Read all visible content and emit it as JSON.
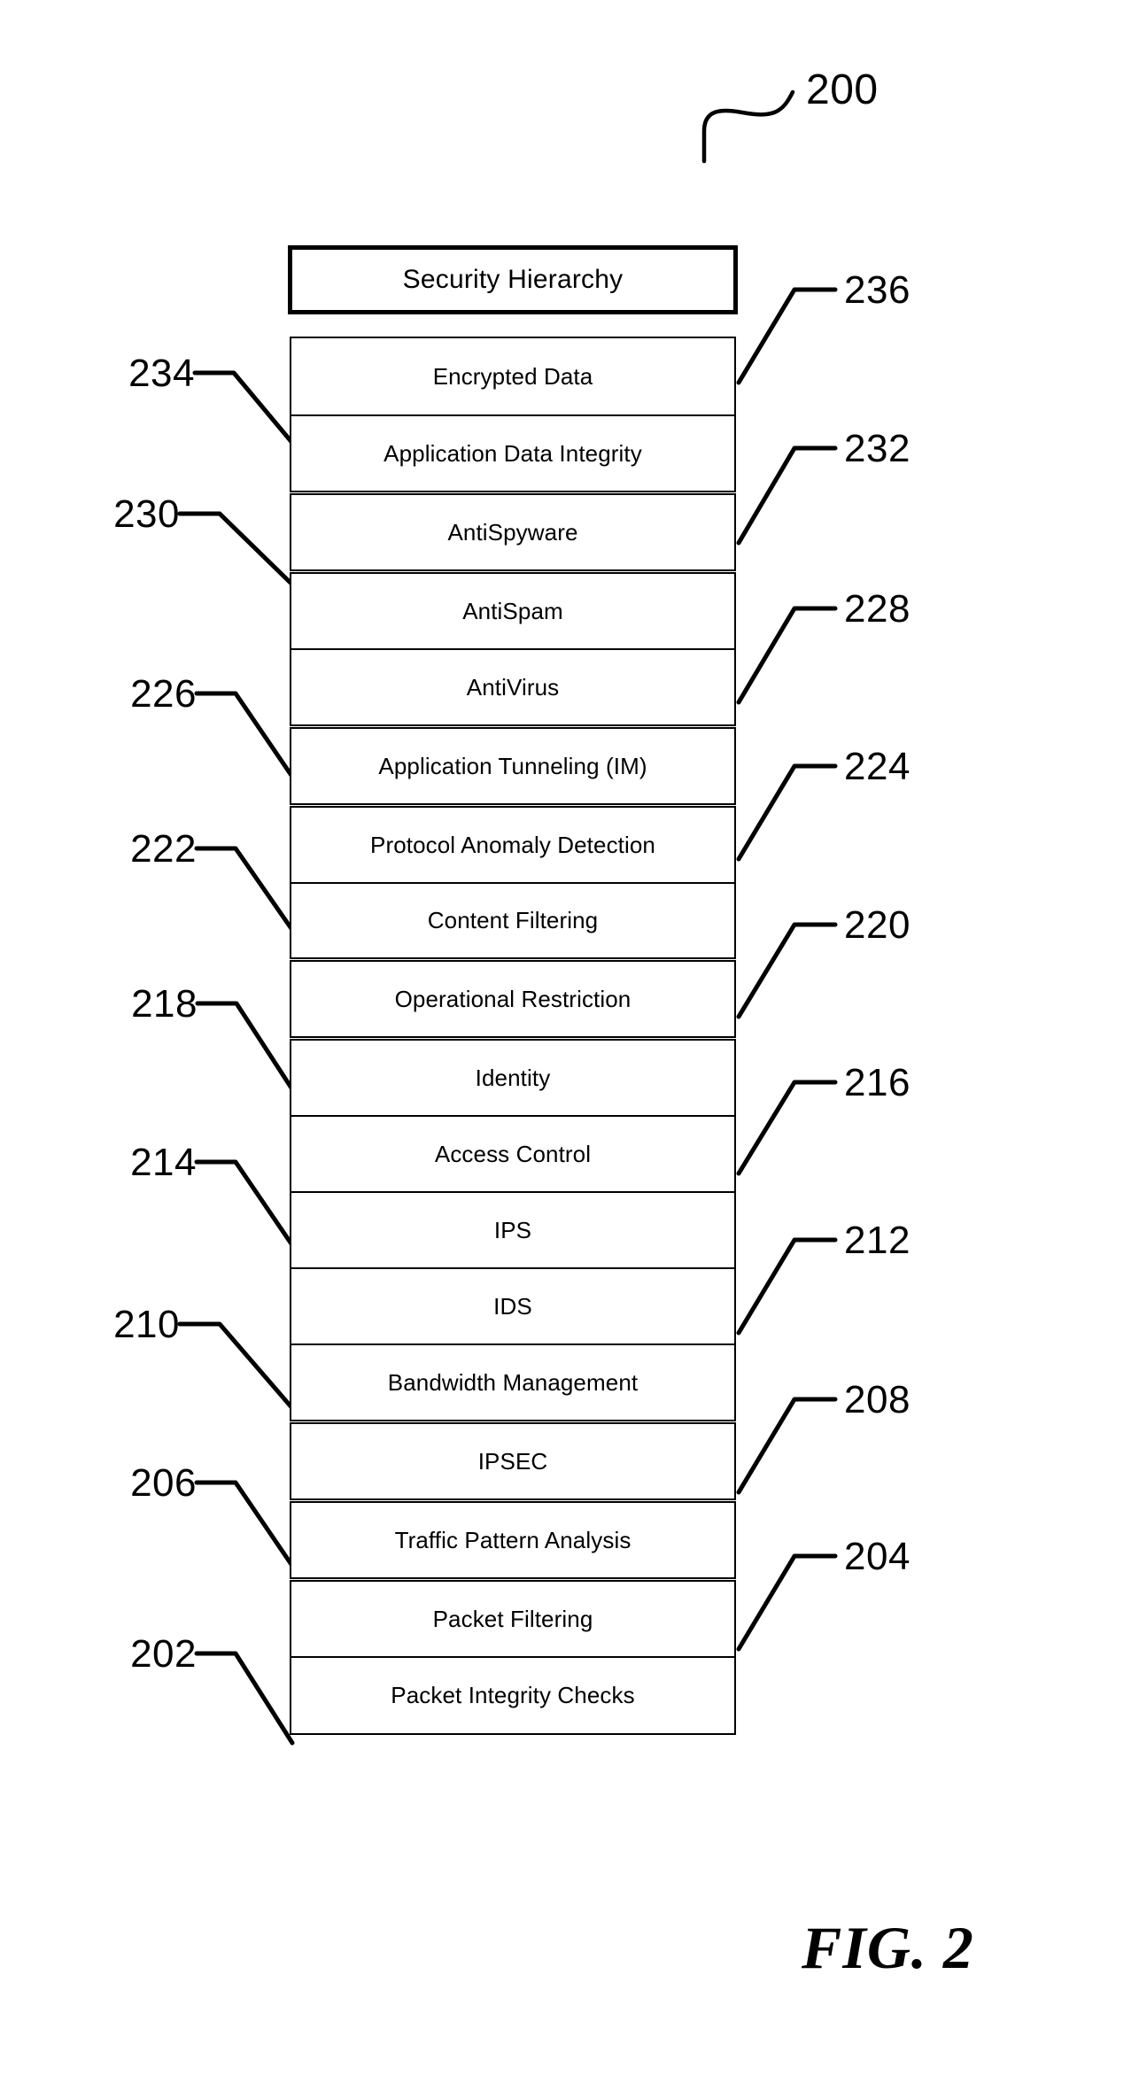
{
  "figure": {
    "caption": "FIG. 2",
    "main_reference_numeral": "200"
  },
  "title_box": {
    "label": "Security Hierarchy"
  },
  "layers": [
    {
      "label": "Encrypted Data"
    },
    {
      "label": "Application Data Integrity"
    },
    {
      "label": "AntiSpyware"
    },
    {
      "label": "AntiSpam"
    },
    {
      "label": "AntiVirus"
    },
    {
      "label": "Application Tunneling (IM)"
    },
    {
      "label": "Protocol Anomaly Detection"
    },
    {
      "label": "Content Filtering"
    },
    {
      "label": "Operational Restriction"
    },
    {
      "label": "Identity"
    },
    {
      "label": "Access Control"
    },
    {
      "label": "IPS"
    },
    {
      "label": "IDS"
    },
    {
      "label": "Bandwidth Management"
    },
    {
      "label": "IPSEC"
    },
    {
      "label": "Traffic Pattern Analysis"
    },
    {
      "label": "Packet Filtering"
    },
    {
      "label": "Packet Integrity Checks"
    }
  ],
  "reference_numerals_left": [
    {
      "value": "234"
    },
    {
      "value": "230"
    },
    {
      "value": "226"
    },
    {
      "value": "222"
    },
    {
      "value": "218"
    },
    {
      "value": "214"
    },
    {
      "value": "210"
    },
    {
      "value": "206"
    },
    {
      "value": "202"
    }
  ],
  "reference_numerals_right": [
    {
      "value": "236"
    },
    {
      "value": "232"
    },
    {
      "value": "228"
    },
    {
      "value": "224"
    },
    {
      "value": "220"
    },
    {
      "value": "216"
    },
    {
      "value": "212"
    },
    {
      "value": "208"
    },
    {
      "value": "204"
    }
  ],
  "colors": {
    "ink": "#000000",
    "paper": "#ffffff"
  }
}
